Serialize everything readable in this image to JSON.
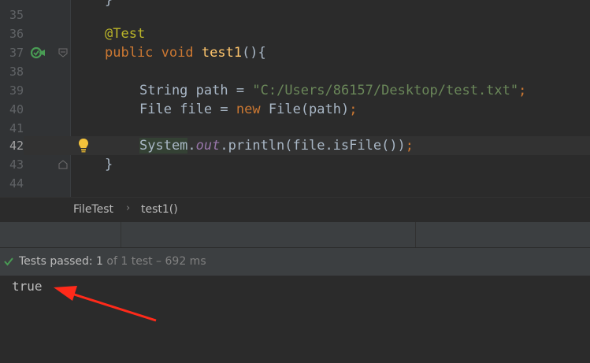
{
  "editor": {
    "lines": [
      {
        "num": "35"
      },
      {
        "num": "36",
        "annotation": "@Test"
      },
      {
        "num": "37",
        "kw1": "public",
        "kw2": "void",
        "method": "test1",
        "rest": "(){"
      },
      {
        "num": "38"
      },
      {
        "num": "39",
        "type": "String",
        "var": "path",
        "eq": "=",
        "str": "\"C:/Users/86157/Desktop/test.txt\"",
        "semi": ";"
      },
      {
        "num": "40",
        "type": "File",
        "var": "file",
        "eq": "=",
        "kw": "new",
        "ctor": "File(path)",
        "semi": ";"
      },
      {
        "num": "41"
      },
      {
        "num": "42",
        "cls": "System",
        "dot": ".",
        "field": "out",
        "call": ".println(file.isFile())",
        "semi": ";"
      },
      {
        "num": "43",
        "brace": "}"
      },
      {
        "num": "44"
      }
    ]
  },
  "breadcrumb": {
    "class_name": "FileTest",
    "separator": "›",
    "method_name": "test1()"
  },
  "test_status": {
    "passed_label": "Tests passed: ",
    "passed_count": "1",
    "detail": " of 1 test – 692 ms",
    "icon": "check-icon",
    "color": "#499c54"
  },
  "console": {
    "output": "true"
  },
  "annotation_arrow": {
    "color": "#ff2a1a"
  }
}
